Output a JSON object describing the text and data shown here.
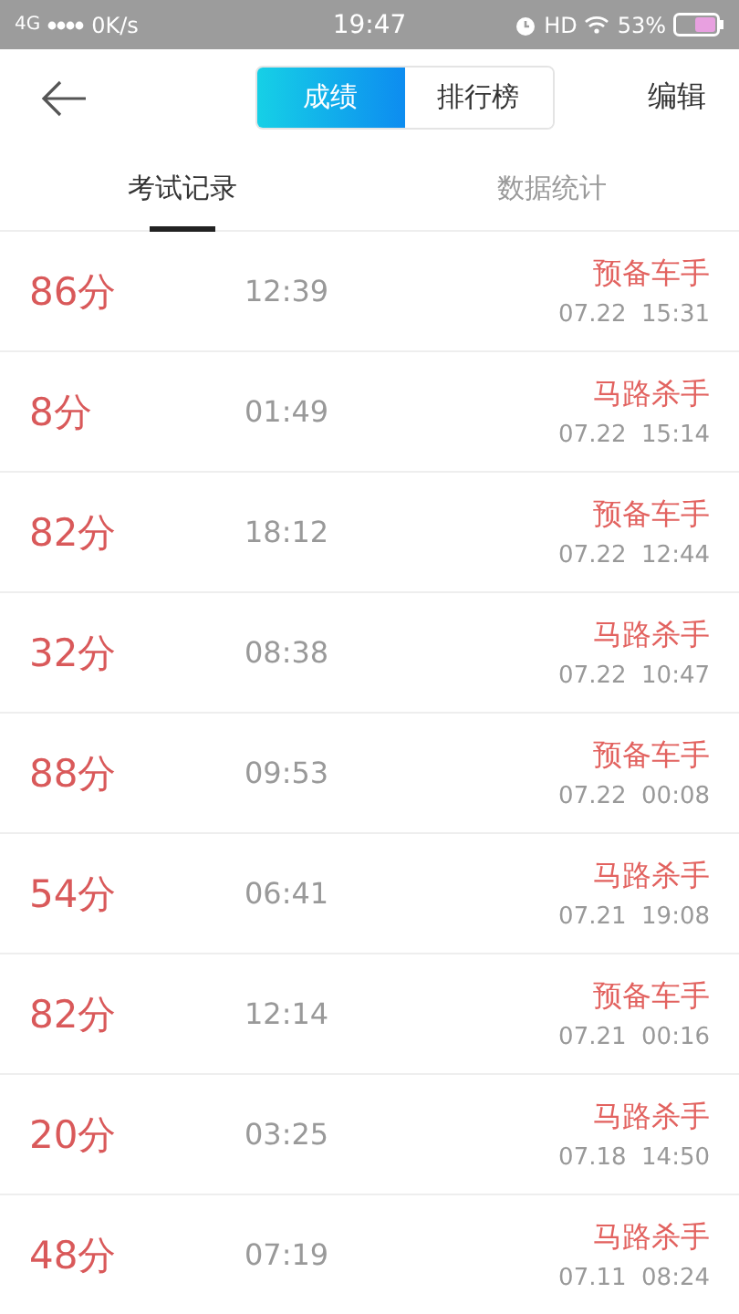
{
  "status_bar": {
    "network": "4G",
    "speed": "0K/s",
    "time": "19:47",
    "hd": "HD",
    "battery": "53%"
  },
  "header": {
    "segments": [
      {
        "label": "成绩",
        "selected": true
      },
      {
        "label": "排行榜",
        "selected": false
      }
    ],
    "action": "编辑"
  },
  "tabs": [
    {
      "label": "考试记录",
      "selected": true
    },
    {
      "label": "数据统计",
      "selected": false
    }
  ],
  "records": [
    {
      "score": "86分",
      "duration": "12:39",
      "title": "预备车手",
      "date": "07.22  15:31"
    },
    {
      "score": "8分",
      "duration": "01:49",
      "title": "马路杀手",
      "date": "07.22  15:14"
    },
    {
      "score": "82分",
      "duration": "18:12",
      "title": "预备车手",
      "date": "07.22  12:44"
    },
    {
      "score": "32分",
      "duration": "08:38",
      "title": "马路杀手",
      "date": "07.22  10:47"
    },
    {
      "score": "88分",
      "duration": "09:53",
      "title": "预备车手",
      "date": "07.22  00:08"
    },
    {
      "score": "54分",
      "duration": "06:41",
      "title": "马路杀手",
      "date": "07.21  19:08"
    },
    {
      "score": "82分",
      "duration": "12:14",
      "title": "预备车手",
      "date": "07.21  00:16"
    },
    {
      "score": "20分",
      "duration": "03:25",
      "title": "马路杀手",
      "date": "07.18  14:50"
    },
    {
      "score": "48分",
      "duration": "07:19",
      "title": "马路杀手",
      "date": "07.11  08:24"
    }
  ]
}
